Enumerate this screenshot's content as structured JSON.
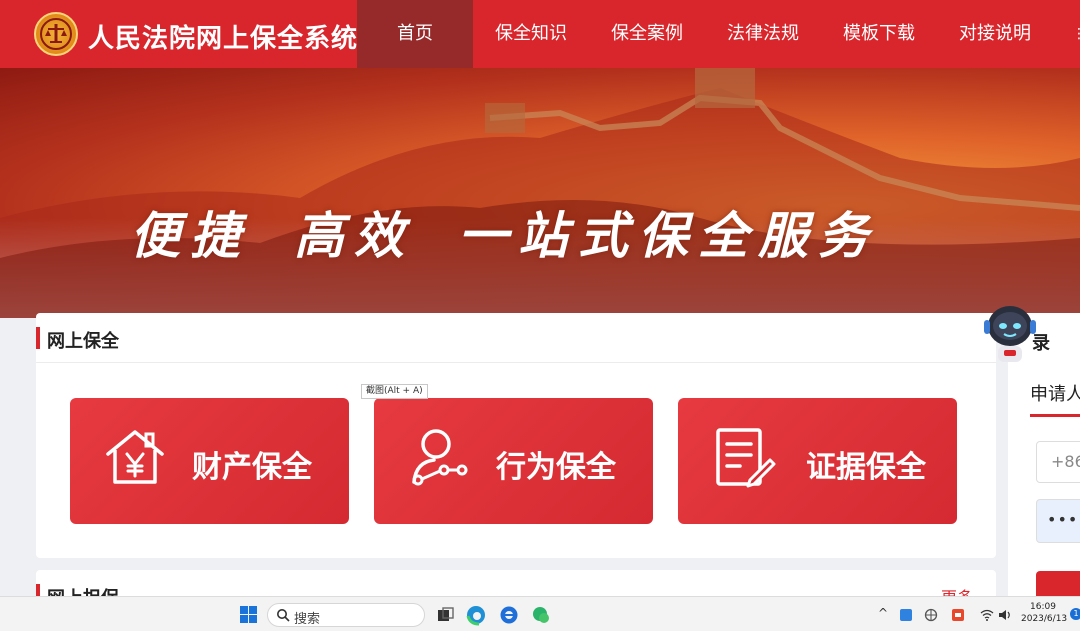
{
  "header": {
    "title": "人民法院网上保全系统",
    "nav": [
      {
        "label": "首页",
        "active": true
      },
      {
        "label": "保全知识"
      },
      {
        "label": "保全案例"
      },
      {
        "label": "法律法规"
      },
      {
        "label": "模板下载"
      },
      {
        "label": "对接说明"
      }
    ],
    "more_glyph": "⋮"
  },
  "banner": {
    "slogan_parts": [
      "便捷",
      "高效",
      "一站式保全服务"
    ]
  },
  "online_preservation": {
    "title": "网上保全",
    "services": [
      {
        "label": "财产保全",
        "icon": "house-yen-icon"
      },
      {
        "label": "行为保全",
        "icon": "person-action-icon"
      },
      {
        "label": "证据保全",
        "icon": "document-edit-icon"
      }
    ]
  },
  "tooltip": {
    "text": "截图(Alt + A)"
  },
  "online_guarantee": {
    "title": "网上担保",
    "more": "更多"
  },
  "login": {
    "title": "录",
    "tab_label": "申请人",
    "phone_value": "+86",
    "password_mask": "••••••"
  },
  "taskbar": {
    "search_placeholder": "搜索",
    "time": "16:09",
    "date": "2023/6/13",
    "notifications": "1"
  },
  "colors": {
    "brand_red": "#d9262c",
    "nav_active": "#962a2a"
  }
}
